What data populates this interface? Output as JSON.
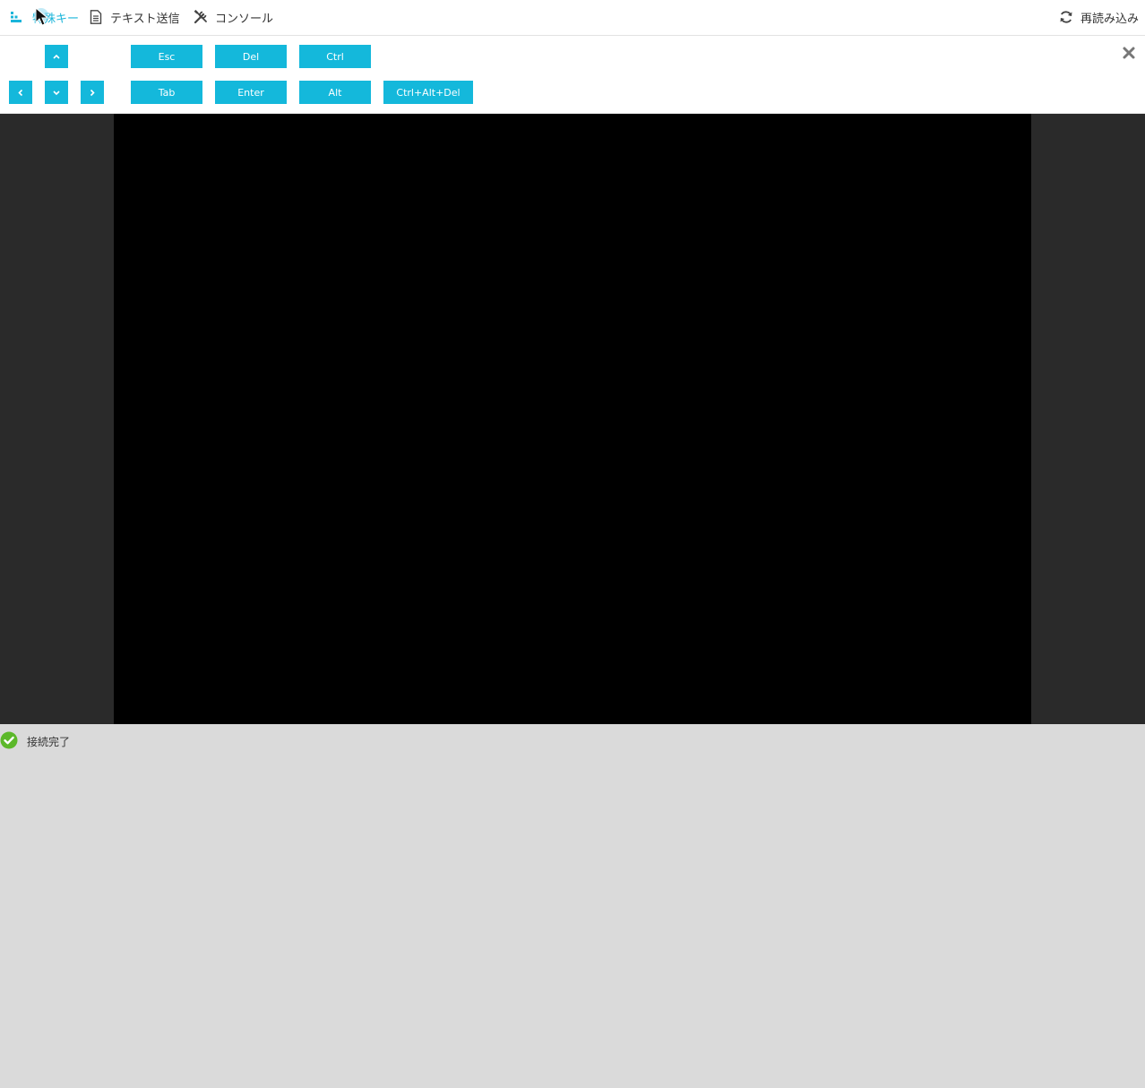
{
  "topbar": {
    "special_keys_label": "特殊キー",
    "send_text_label": "テキスト送信",
    "console_label": "コンソール",
    "reload_label": "再読み込み"
  },
  "keys": {
    "arrow_up": "^",
    "arrow_left": "<",
    "arrow_down": "v",
    "arrow_right": ">",
    "esc": "Esc",
    "del": "Del",
    "ctrl": "Ctrl",
    "tab": "Tab",
    "enter": "Enter",
    "alt": "Alt",
    "ctrl_alt_del": "Ctrl+Alt+Del"
  },
  "status": {
    "text": "接続完了",
    "color": "#5cb82a"
  },
  "colors": {
    "accent": "#14b8db",
    "console_bg": "#000000",
    "console_frame": "#2a2a2a"
  },
  "icons": {
    "special_keys": "keyboard-icon",
    "send_text": "document-icon",
    "console": "tools-icon",
    "reload": "refresh-icon",
    "close": "close-icon",
    "status": "check-circle-icon"
  }
}
